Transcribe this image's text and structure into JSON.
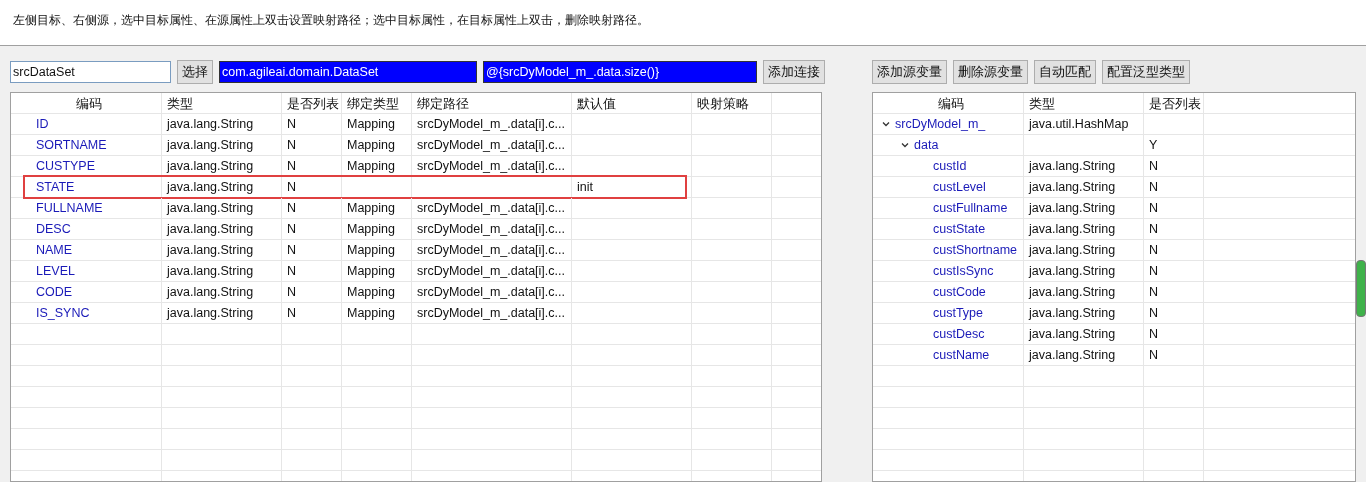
{
  "instruction": "左侧目标、右侧源，选中目标属性、在源属性上双击设置映射路径；选中目标属性，在目标属性上双击，删除映射路径。",
  "toolbar": {
    "fields": [
      {
        "value": "srcDataSet",
        "selected": false
      },
      {
        "value": "com.agileai.domain.DataSet",
        "selected": true
      },
      {
        "value": "@{srcDyModel_m_.data.size()}",
        "selected": true
      }
    ],
    "select_button": "选择",
    "add_link_button": "添加连接"
  },
  "source_buttons": [
    "添加源变量",
    "删除源变量",
    "自动匹配",
    "配置泛型类型"
  ],
  "target_table": {
    "columns": [
      "编码",
      "类型",
      "是否列表",
      "绑定类型",
      "绑定路径",
      "默认值",
      "映射策略"
    ],
    "rows": [
      {
        "code": "ID",
        "type": "java.lang.String",
        "is_list": "N",
        "bind_type": "Mapping",
        "bind_path": "srcDyModel_m_.data[i].c...",
        "highlighted": false
      },
      {
        "code": "SORTNAME",
        "type": "java.lang.String",
        "is_list": "N",
        "bind_type": "Mapping",
        "bind_path": "srcDyModel_m_.data[i].c...",
        "highlighted": false
      },
      {
        "code": "CUSTYPE",
        "type": "java.lang.String",
        "is_list": "N",
        "bind_type": "Mapping",
        "bind_path": "srcDyModel_m_.data[i].c...",
        "highlighted": false
      },
      {
        "code": "STATE",
        "type": "java.lang.String",
        "is_list": "N",
        "default": "init",
        "highlighted": true
      },
      {
        "code": "FULLNAME",
        "type": "java.lang.String",
        "is_list": "N",
        "bind_type": "Mapping",
        "bind_path": "srcDyModel_m_.data[i].c...",
        "highlighted": false
      },
      {
        "code": "DESC",
        "type": "java.lang.String",
        "is_list": "N",
        "bind_type": "Mapping",
        "bind_path": "srcDyModel_m_.data[i].c...",
        "highlighted": false
      },
      {
        "code": "NAME",
        "type": "java.lang.String",
        "is_list": "N",
        "bind_type": "Mapping",
        "bind_path": "srcDyModel_m_.data[i].c...",
        "highlighted": false
      },
      {
        "code": "LEVEL",
        "type": "java.lang.String",
        "is_list": "N",
        "bind_type": "Mapping",
        "bind_path": "srcDyModel_m_.data[i].c...",
        "highlighted": false
      },
      {
        "code": "CODE",
        "type": "java.lang.String",
        "is_list": "N",
        "bind_type": "Mapping",
        "bind_path": "srcDyModel_m_.data[i].c...",
        "highlighted": false
      },
      {
        "code": "IS_SYNC",
        "type": "java.lang.String",
        "is_list": "N",
        "bind_type": "Mapping",
        "bind_path": "srcDyModel_m_.data[i].c...",
        "highlighted": false
      }
    ]
  },
  "source_tree": {
    "columns": [
      "编码",
      "类型",
      "是否列表"
    ],
    "nodes": [
      {
        "name": "srcDyModel_m_",
        "type": "java.util.HashMap",
        "expanded": true,
        "children": [
          {
            "name": "data",
            "is_list": "Y",
            "expanded": true,
            "children": [
              {
                "name": "custId",
                "type": "java.lang.String",
                "is_list": "N"
              },
              {
                "name": "custLevel",
                "type": "java.lang.String",
                "is_list": "N"
              },
              {
                "name": "custFullname",
                "type": "java.lang.String",
                "is_list": "N"
              },
              {
                "name": "custState",
                "type": "java.lang.String",
                "is_list": "N"
              },
              {
                "name": "custShortname",
                "type": "java.lang.String",
                "is_list": "N"
              },
              {
                "name": "custIsSync",
                "type": "java.lang.String",
                "is_list": "N"
              },
              {
                "name": "custCode",
                "type": "java.lang.String",
                "is_list": "N"
              },
              {
                "name": "custType",
                "type": "java.lang.String",
                "is_list": "N"
              },
              {
                "name": "custDesc",
                "type": "java.lang.String",
                "is_list": "N"
              },
              {
                "name": "custName",
                "type": "java.lang.String",
                "is_list": "N"
              }
            ]
          }
        ]
      }
    ]
  }
}
